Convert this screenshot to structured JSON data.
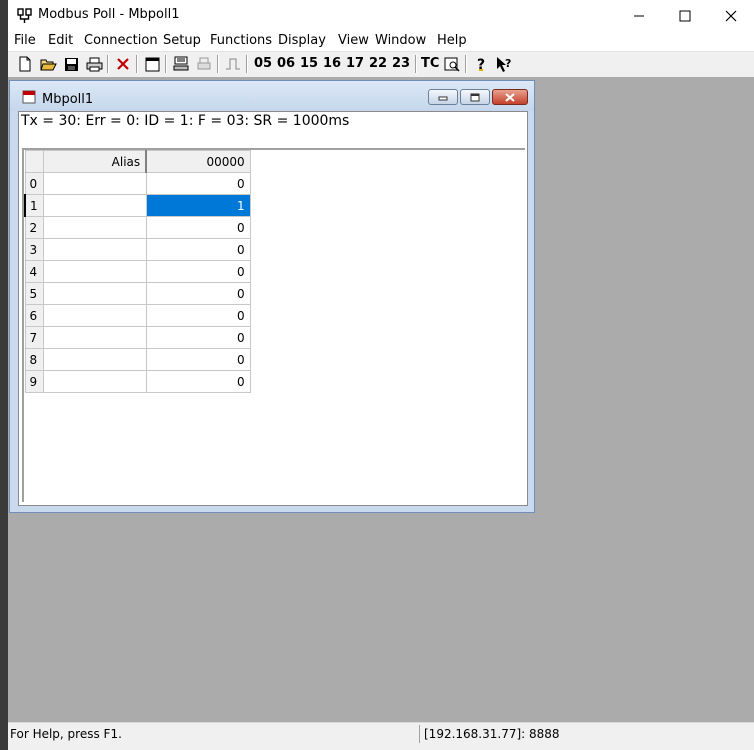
{
  "app": {
    "title": "Modbus Poll - Mbpoll1",
    "minimize_icon": "minimize-icon",
    "maximize_icon": "maximize-icon",
    "close_icon": "close-icon"
  },
  "menu": [
    "File",
    "Edit",
    "Connection",
    "Setup",
    "Functions",
    "Display",
    "View",
    "Window",
    "Help"
  ],
  "toolbar": {
    "function_codes": [
      "05",
      "06",
      "15",
      "16",
      "17",
      "22",
      "23"
    ],
    "tc_label": "TC",
    "icons": [
      "new-icon",
      "open-icon",
      "save-icon",
      "print-icon",
      "disconnect-icon",
      "window-icon",
      "read-write-icon",
      "print-disabled-icon",
      "pulse-icon",
      "tc-scan-icon",
      "help-icon",
      "context-help-icon"
    ]
  },
  "child_window": {
    "title": "Mbpoll1",
    "status": "Tx = 30: Err = 0: ID = 1: F = 03: SR = 1000ms",
    "grid": {
      "headers": {
        "alias": "Alias",
        "value": "00000"
      },
      "rows": [
        {
          "index": "0",
          "alias": "",
          "value": "0"
        },
        {
          "index": "1",
          "alias": "",
          "value": "1"
        },
        {
          "index": "2",
          "alias": "",
          "value": "0"
        },
        {
          "index": "3",
          "alias": "",
          "value": "0"
        },
        {
          "index": "4",
          "alias": "",
          "value": "0"
        },
        {
          "index": "5",
          "alias": "",
          "value": "0"
        },
        {
          "index": "6",
          "alias": "",
          "value": "0"
        },
        {
          "index": "7",
          "alias": "",
          "value": "0"
        },
        {
          "index": "8",
          "alias": "",
          "value": "0"
        },
        {
          "index": "9",
          "alias": "",
          "value": "0"
        }
      ],
      "selected_row": "1"
    }
  },
  "statusbar": {
    "help_text": "For Help, press F1.",
    "connection": "[192.168.31.77]: 8888"
  },
  "colors": {
    "selection": "#0078d7",
    "mdi_background": "#ababab"
  }
}
